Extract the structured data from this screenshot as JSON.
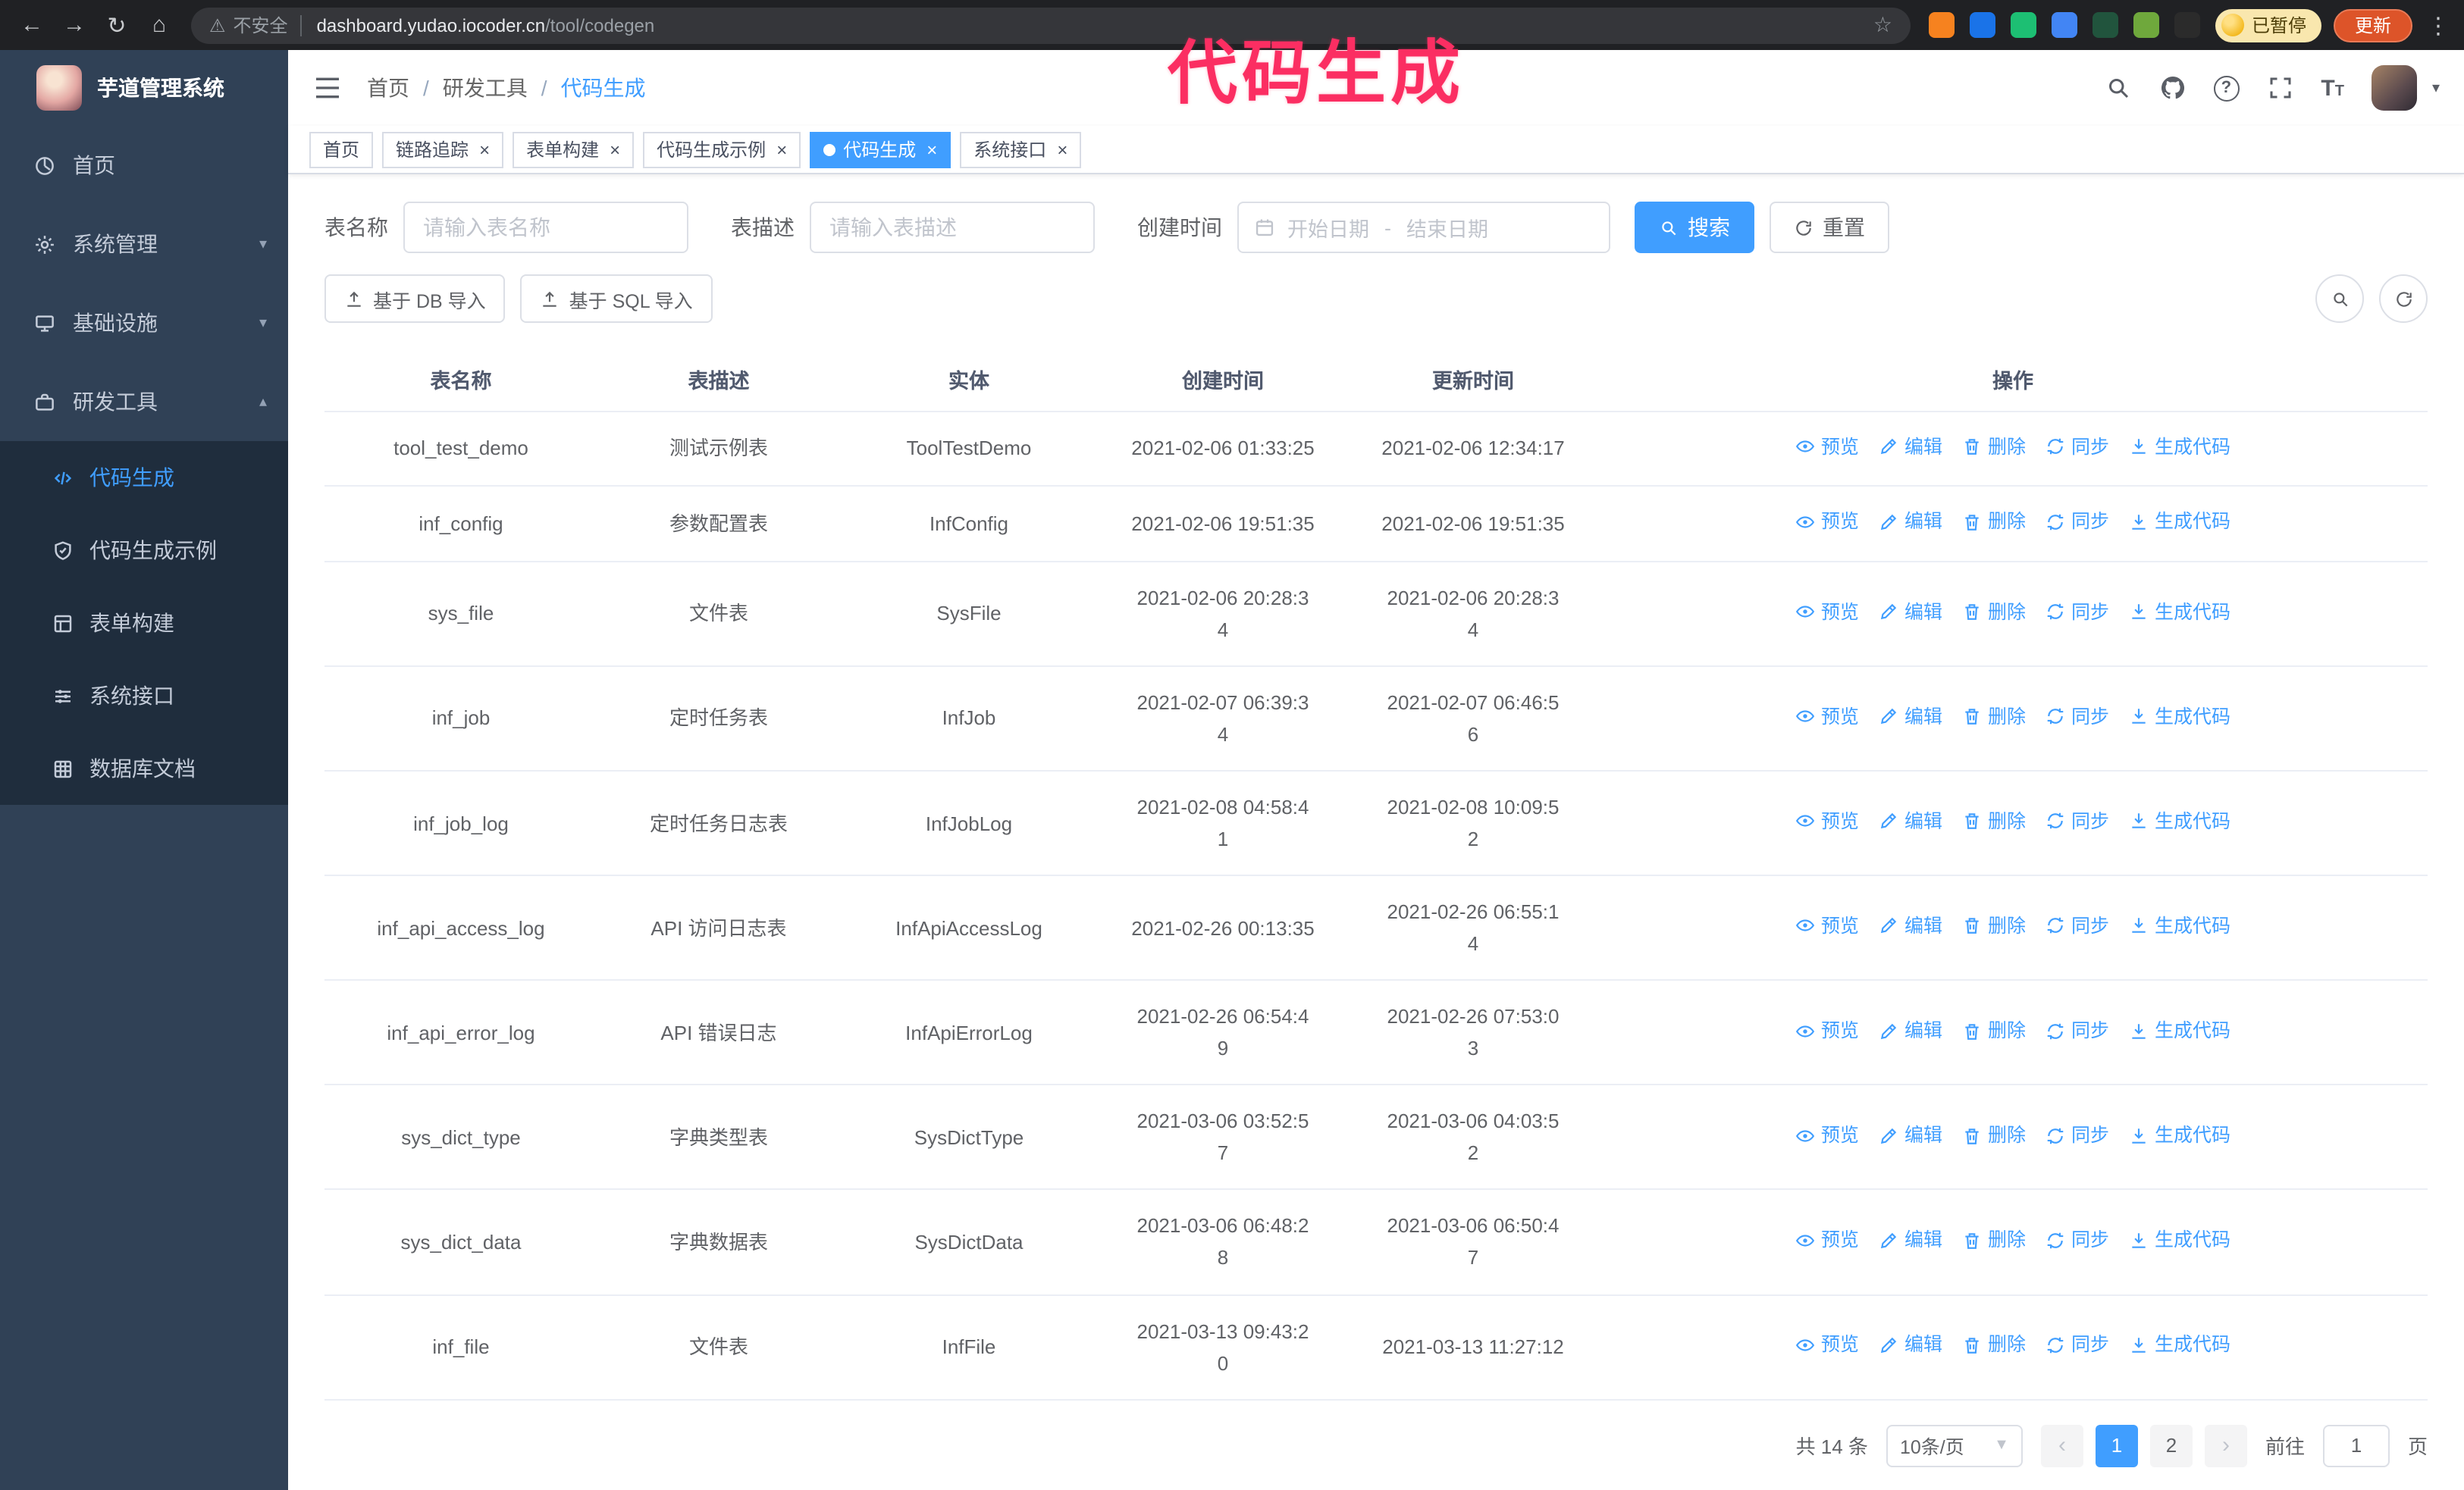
{
  "colors": {
    "accent": "#409eff",
    "annotation": "#fb2e62",
    "sidebar_bg": "#304156",
    "submenu_bg": "#1f2d3d"
  },
  "annotation": {
    "text": "代码生成"
  },
  "chrome": {
    "security_label": "不安全",
    "url_domain": "dashboard.yudao.iocoder.cn",
    "url_path": "/tool/codegen",
    "paused_label": "已暂停",
    "update_label": "更新",
    "extensions": [
      {
        "name": "extension-orange-icon",
        "color": "#f6821f"
      },
      {
        "name": "extension-blue-drop-icon",
        "color": "#1a73e8"
      },
      {
        "name": "extension-green-check-icon",
        "color": "#1dbf73"
      },
      {
        "name": "extension-blue-people-icon",
        "color": "#4285f4"
      },
      {
        "name": "extension-dark-green-icon",
        "color": "#21543d"
      },
      {
        "name": "extension-leaf-icon",
        "color": "#6fa83c"
      },
      {
        "name": "extension-dark-icon",
        "color": "#2b2b2b"
      }
    ]
  },
  "sidebar": {
    "logo_title": "芋道管理系统",
    "items": [
      {
        "id": "home",
        "label": "首页",
        "icon": "dashboard"
      },
      {
        "id": "system",
        "label": "系统管理",
        "icon": "gear",
        "chevron": "down"
      },
      {
        "id": "infra",
        "label": "基础设施",
        "icon": "infra",
        "chevron": "down"
      },
      {
        "id": "devtools",
        "label": "研发工具",
        "icon": "tools",
        "chevron": "up",
        "expanded": true
      }
    ],
    "subitems": [
      {
        "id": "codegen",
        "label": "代码生成",
        "icon": "code",
        "active": true
      },
      {
        "id": "codegen-demo",
        "label": "代码生成示例",
        "icon": "shield"
      },
      {
        "id": "form-build",
        "label": "表单构建",
        "icon": "form"
      },
      {
        "id": "api",
        "label": "系统接口",
        "icon": "sliders"
      },
      {
        "id": "db-doc",
        "label": "数据库文档",
        "icon": "dbdoc"
      }
    ]
  },
  "navbar": {
    "breadcrumb": [
      "首页",
      "研发工具",
      "代码生成"
    ],
    "separator": "/"
  },
  "tabs": [
    {
      "id": "home",
      "label": "首页",
      "closable": false
    },
    {
      "id": "tracing",
      "label": "链路追踪"
    },
    {
      "id": "form-build",
      "label": "表单构建"
    },
    {
      "id": "codegen-demo",
      "label": "代码生成示例"
    },
    {
      "id": "codegen",
      "label": "代码生成",
      "active": true
    },
    {
      "id": "api",
      "label": "系统接口"
    }
  ],
  "filters": {
    "name_label": "表名称",
    "name_placeholder": "请输入表名称",
    "desc_label": "表描述",
    "desc_placeholder": "请输入表描述",
    "time_label": "创建时间",
    "start_placeholder": "开始日期",
    "range_separator": "-",
    "end_placeholder": "结束日期",
    "search_label": "搜索",
    "reset_label": "重置"
  },
  "toolbar": {
    "import_db_label": "基于 DB 导入",
    "import_sql_label": "基于 SQL 导入"
  },
  "table": {
    "columns": [
      "表名称",
      "表描述",
      "实体",
      "创建时间",
      "更新时间",
      "操作"
    ],
    "actions": [
      "预览",
      "编辑",
      "删除",
      "同步",
      "生成代码"
    ],
    "rows": [
      {
        "name": "tool_test_demo",
        "desc": "测试示例表",
        "entity": "ToolTestDemo",
        "created": "2021-02-06 01:33:25",
        "updated": "2021-02-06 12:34:17"
      },
      {
        "name": "inf_config",
        "desc": "参数配置表",
        "entity": "InfConfig",
        "created": "2021-02-06 19:51:35",
        "updated": "2021-02-06 19:51:35"
      },
      {
        "name": "sys_file",
        "desc": "文件表",
        "entity": "SysFile",
        "created": "2021-02-06 20:28:3\n4",
        "updated": "2021-02-06 20:28:3\n4"
      },
      {
        "name": "inf_job",
        "desc": "定时任务表",
        "entity": "InfJob",
        "created": "2021-02-07 06:39:3\n4",
        "updated": "2021-02-07 06:46:5\n6"
      },
      {
        "name": "inf_job_log",
        "desc": "定时任务日志表",
        "entity": "InfJobLog",
        "created": "2021-02-08 04:58:4\n1",
        "updated": "2021-02-08 10:09:5\n2"
      },
      {
        "name": "inf_api_access_log",
        "desc": "API 访问日志表",
        "entity": "InfApiAccessLog",
        "created": "2021-02-26 00:13:35",
        "updated": "2021-02-26 06:55:1\n4"
      },
      {
        "name": "inf_api_error_log",
        "desc": "API 错误日志",
        "entity": "InfApiErrorLog",
        "created": "2021-02-26 06:54:4\n9",
        "updated": "2021-02-26 07:53:0\n3"
      },
      {
        "name": "sys_dict_type",
        "desc": "字典类型表",
        "entity": "SysDictType",
        "created": "2021-03-06 03:52:5\n7",
        "updated": "2021-03-06 04:03:5\n2"
      },
      {
        "name": "sys_dict_data",
        "desc": "字典数据表",
        "entity": "SysDictData",
        "created": "2021-03-06 06:48:2\n8",
        "updated": "2021-03-06 06:50:4\n7"
      },
      {
        "name": "inf_file",
        "desc": "文件表",
        "entity": "InfFile",
        "created": "2021-03-13 09:43:2\n0",
        "updated": "2021-03-13 11:27:12"
      }
    ]
  },
  "pagination": {
    "total": "共 14 条",
    "page_size": "10条/页",
    "pages": [
      "1",
      "2"
    ],
    "active_page": "1",
    "goto_label": "前往",
    "goto_value": "1",
    "page_unit": "页"
  }
}
